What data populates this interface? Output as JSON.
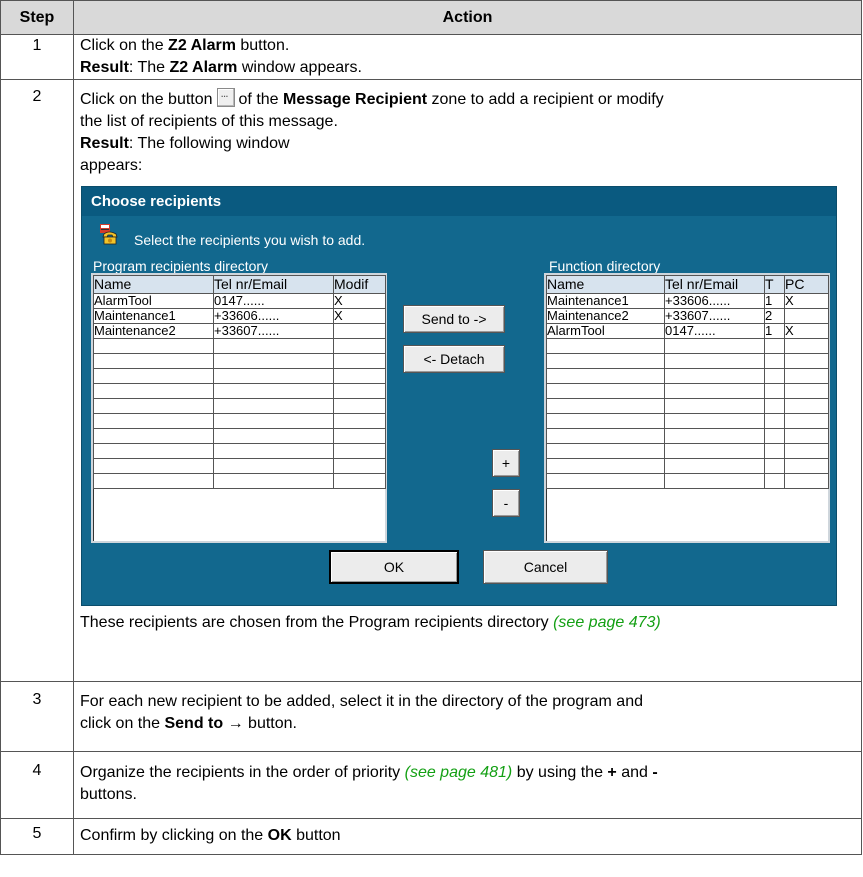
{
  "table": {
    "header": {
      "step": "Step",
      "action": "Action"
    },
    "rows": [
      {
        "step": "1",
        "line1": {
          "a": "Click on the ",
          "b": "Z2 Alarm",
          "c": " button."
        },
        "line2": {
          "a": "Result",
          "b": ": The ",
          "c": "Z2 Alarm",
          "d": " window appears."
        }
      },
      {
        "step": "2",
        "line1": {
          "a": "Click on the button",
          "b": "of the ",
          "c": "Message Recipient",
          "d": " zone to add a recipient or modify"
        },
        "line2": "the list of recipients of this message.",
        "line3": {
          "a": "Result",
          "b": ": The following window"
        },
        "line4": "appears:",
        "footer": {
          "a": "These recipients are chosen from the Program recipients directory ",
          "link": "(see page 473)"
        }
      },
      {
        "step": "3",
        "line1": "For each new recipient to be added, select it in the directory of the program and",
        "line2": {
          "a": "click on the ",
          "b": "Send to",
          "arrow": " →",
          "c": " button."
        }
      },
      {
        "step": "4",
        "line1": {
          "a": "Organize the recipients in the order of priority ",
          "link": "(see page 481)",
          "b": " by using the ",
          "plus": "+",
          "c": " and ",
          "minus": "-"
        },
        "line2": "buttons."
      },
      {
        "step": "5",
        "line1": {
          "a": "Confirm by clicking on the ",
          "b": "OK",
          "c": " button"
        }
      }
    ]
  },
  "dialog": {
    "title": "Choose recipients",
    "instruction": "Select the recipients you wish to add.",
    "left_label": "Program recipients directory",
    "right_label": "Function directory",
    "left_columns": [
      "Name",
      "Tel nr/Email",
      "Modif"
    ],
    "left_rows": [
      [
        "AlarmTool",
        "0147......",
        "X"
      ],
      [
        "Maintenance1",
        "+33606......",
        "X"
      ],
      [
        "Maintenance2",
        "+33607......",
        ""
      ],
      [
        "",
        "",
        ""
      ],
      [
        "",
        "",
        ""
      ],
      [
        "",
        "",
        ""
      ],
      [
        "",
        "",
        ""
      ],
      [
        "",
        "",
        ""
      ],
      [
        "",
        "",
        ""
      ],
      [
        "",
        "",
        ""
      ],
      [
        "",
        "",
        ""
      ],
      [
        "",
        "",
        ""
      ],
      [
        "",
        "",
        ""
      ]
    ],
    "right_columns": [
      "Name",
      "Tel nr/Email",
      "T",
      "PC"
    ],
    "right_rows": [
      [
        "Maintenance1",
        "+33606......",
        "1",
        "X"
      ],
      [
        "Maintenance2",
        "+33607......",
        "2",
        ""
      ],
      [
        "AlarmTool",
        " 0147......",
        "1",
        "X"
      ],
      [
        "",
        "",
        "",
        ""
      ],
      [
        "",
        "",
        "",
        ""
      ],
      [
        "",
        "",
        "",
        ""
      ],
      [
        "",
        "",
        "",
        ""
      ],
      [
        "",
        "",
        "",
        ""
      ],
      [
        "",
        "",
        "",
        ""
      ],
      [
        "",
        "",
        "",
        ""
      ],
      [
        "",
        "",
        "",
        ""
      ],
      [
        "",
        "",
        "",
        ""
      ],
      [
        "",
        "",
        "",
        ""
      ]
    ],
    "buttons": {
      "send_to": "Send to ->",
      "detach": "<- Detach",
      "plus": "+",
      "minus": "-",
      "ok": "OK",
      "cancel": "Cancel"
    },
    "colors": {
      "background": "#12688e",
      "title_bar": "#0a5a80",
      "link": "#14a014"
    }
  }
}
